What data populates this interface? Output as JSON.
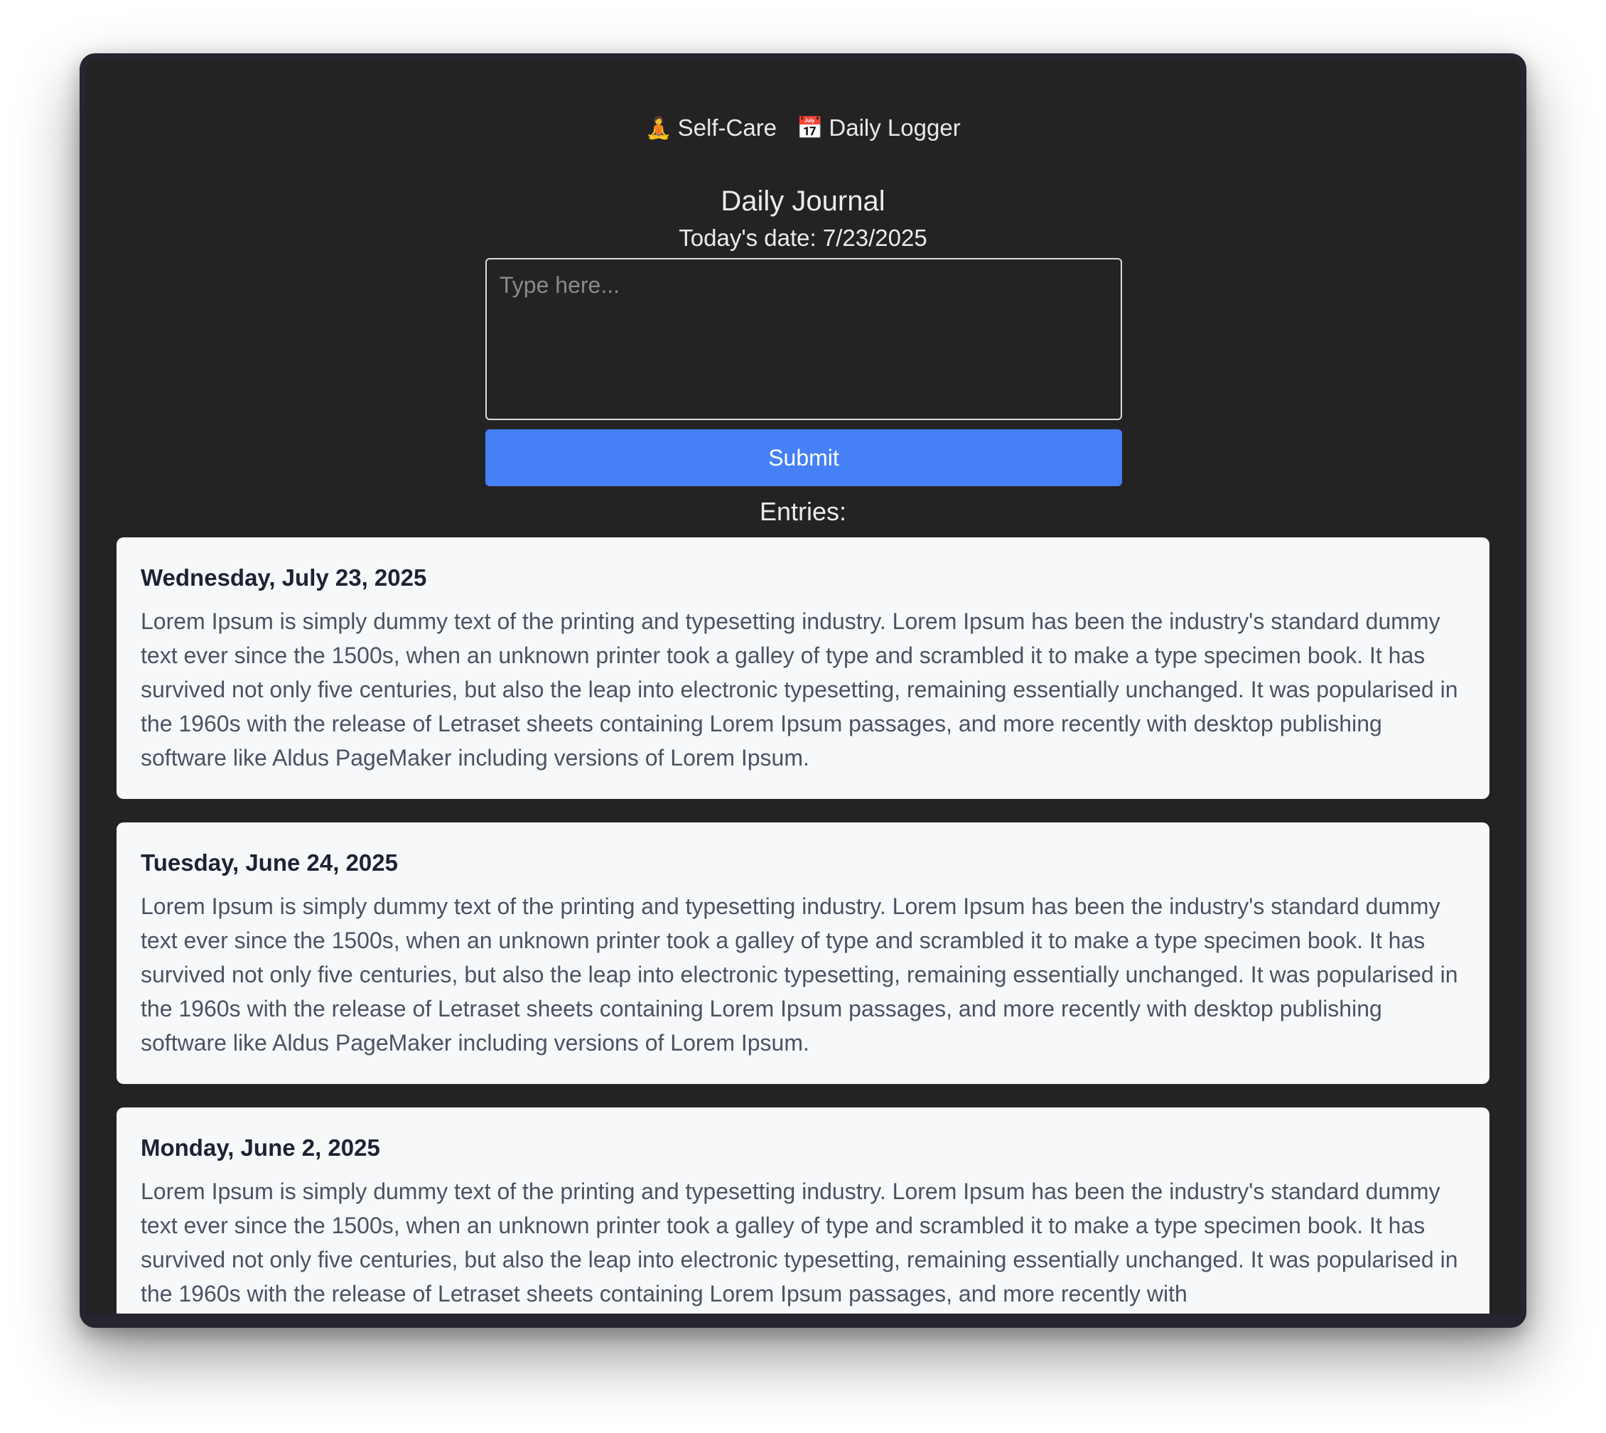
{
  "nav": {
    "items": [
      {
        "emoji": "🧘",
        "label": "Self-Care"
      },
      {
        "emoji": "📅",
        "label": "Daily Logger"
      }
    ]
  },
  "journal": {
    "title": "Daily Journal",
    "date_label": "Today's date:",
    "date_value": "7/23/2025",
    "placeholder": "Type here...",
    "input_value": "",
    "submit_label": "Submit"
  },
  "entries": {
    "heading": "Entries:",
    "items": [
      {
        "date": "Wednesday, July 23, 2025",
        "text": "Lorem Ipsum is simply dummy text of the printing and typesetting industry. Lorem Ipsum has been the industry's standard dummy text ever since the 1500s, when an unknown printer took a galley of type and scrambled it to make a type specimen book. It has survived not only five centuries, but also the leap into electronic typesetting, remaining essentially unchanged. It was popularised in the 1960s with the release of Letraset sheets containing Lorem Ipsum passages, and more recently with desktop publishing software like Aldus PageMaker including versions of Lorem Ipsum."
      },
      {
        "date": "Tuesday, June 24, 2025",
        "text": "Lorem Ipsum is simply dummy text of the printing and typesetting industry. Lorem Ipsum has been the industry's standard dummy text ever since the 1500s, when an unknown printer took a galley of type and scrambled it to make a type specimen book. It has survived not only five centuries, but also the leap into electronic typesetting, remaining essentially unchanged. It was popularised in the 1960s with the release of Letraset sheets containing Lorem Ipsum passages, and more recently with desktop publishing software like Aldus PageMaker including versions of Lorem Ipsum."
      },
      {
        "date": "Monday, June 2, 2025",
        "text": "Lorem Ipsum is simply dummy text of the printing and typesetting industry. Lorem Ipsum has been the industry's standard dummy text ever since the 1500s, when an unknown printer took a galley of type and scrambled it to make a type specimen book. It has survived not only five centuries, but also the leap into electronic typesetting, remaining essentially unchanged. It was popularised in the 1960s with the release of Letraset sheets containing Lorem Ipsum passages, and more recently with"
      }
    ]
  },
  "colors": {
    "background": "#232323",
    "frame": "#272430",
    "accent": "#4580f7",
    "card": "#f7f8fa",
    "card_title": "#1c2333",
    "card_text": "#4b5261"
  }
}
